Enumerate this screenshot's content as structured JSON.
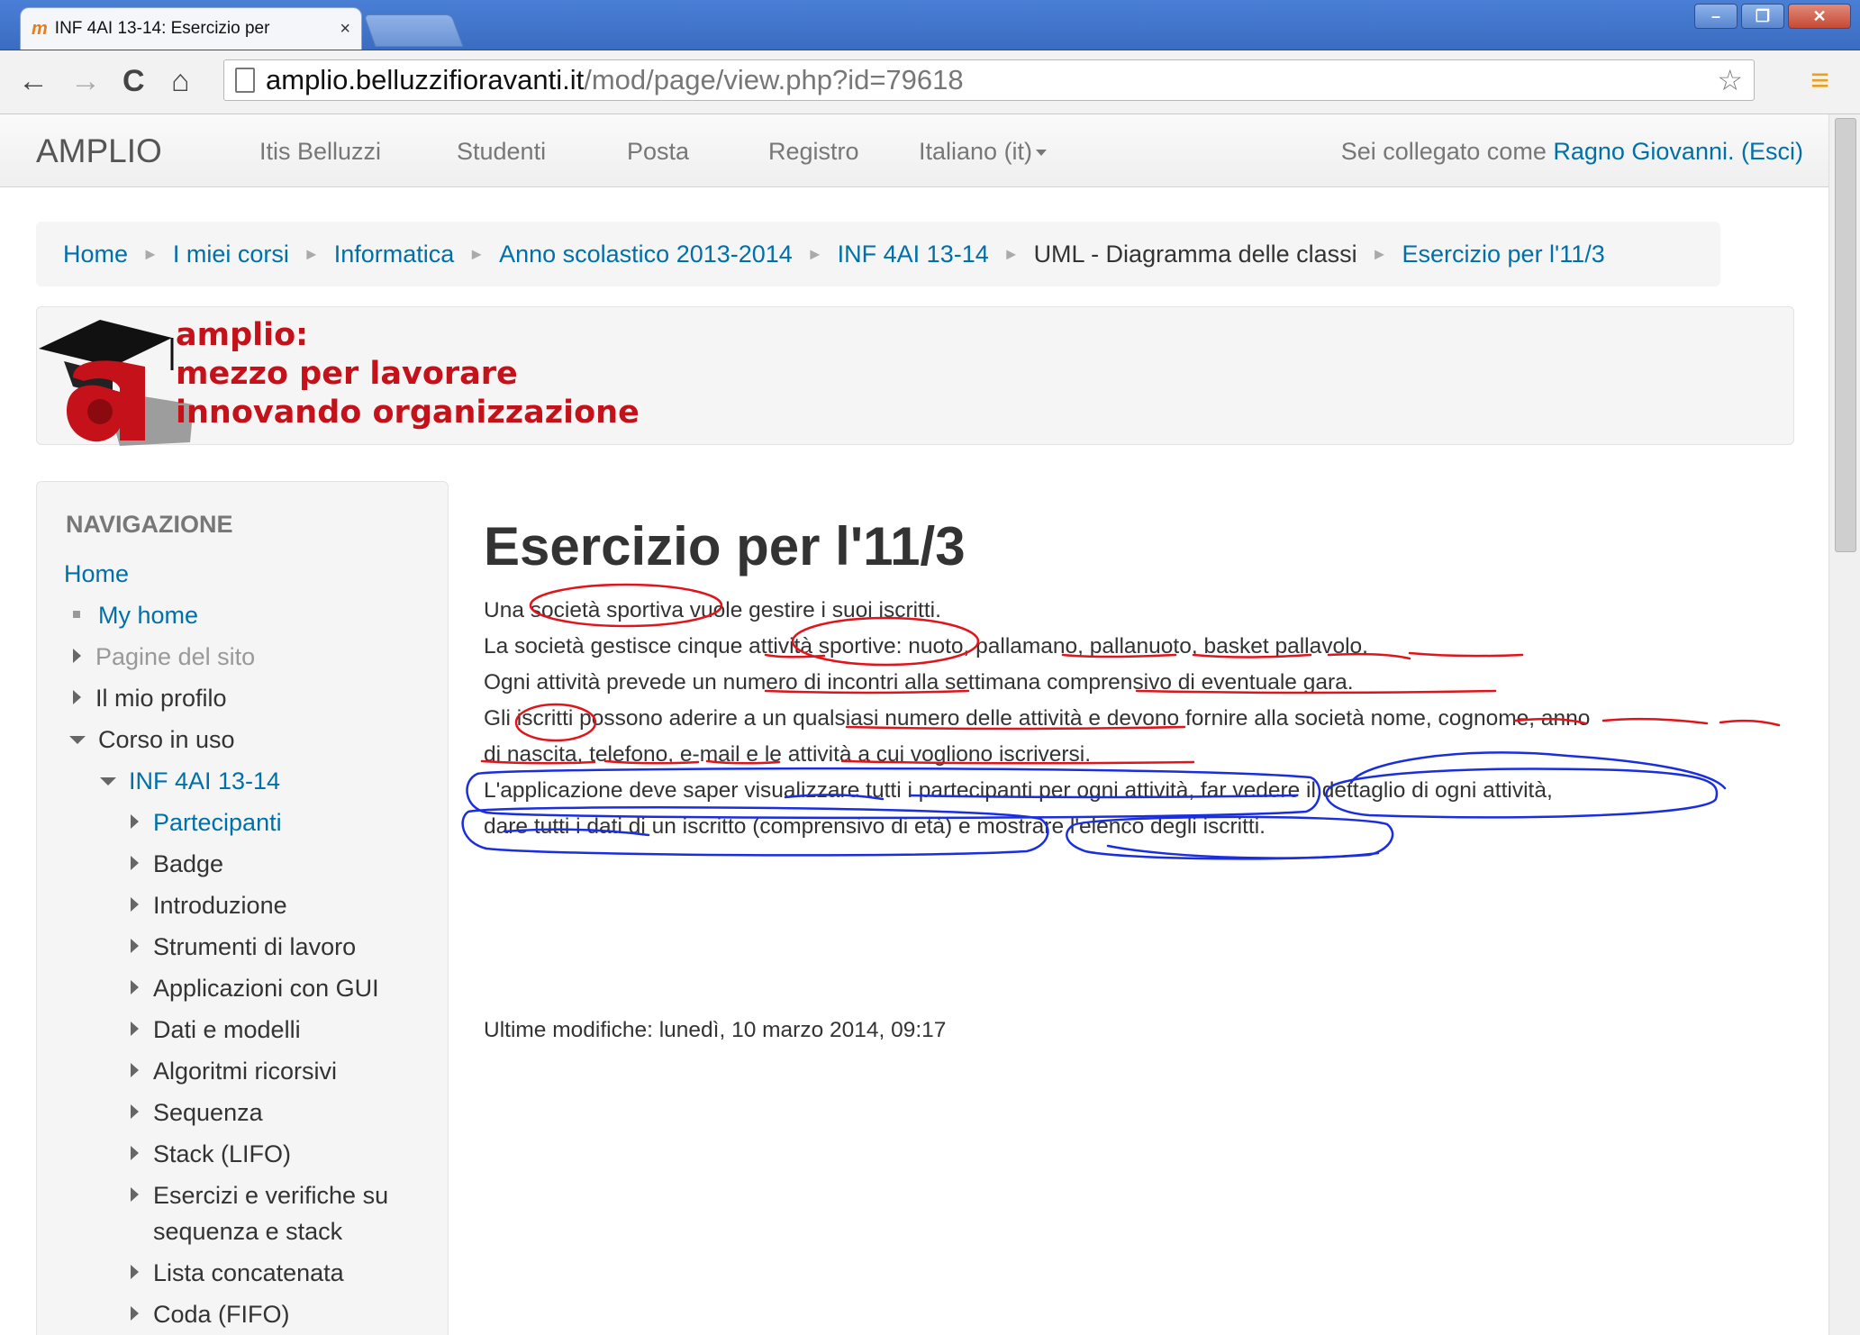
{
  "browser": {
    "tab_title": "INF 4AI 13-14: Esercizio per",
    "tab_close": "×",
    "url_host": "amplio.belluzzifioravanti.it",
    "url_path": "/mod/page/view.php?id=79618",
    "window_buttons": [
      "minimize",
      "maximize",
      "close"
    ]
  },
  "navbar": {
    "brand": "AMPLIO",
    "items": [
      "Itis Belluzzi",
      "Studenti",
      "Posta",
      "Registro",
      "Italiano (it)"
    ],
    "login_prefix": "Sei collegato come ",
    "user": "Ragno Giovanni.",
    "logout": "(Esci)"
  },
  "breadcrumb": [
    "Home",
    "I miei corsi",
    "Informatica",
    "Anno scolastico 2013-2014",
    "INF 4AI 13-14",
    "UML - Diagramma delle classi",
    "Esercizio per l'11/3"
  ],
  "logo": {
    "line1": "amplio:",
    "line2": "mezzo per lavorare",
    "line3": "innovando organizzazione"
  },
  "navigation": {
    "title": "NAVIGAZIONE",
    "home": "Home",
    "my_home": "My home",
    "site_pages": "Pagine del sito",
    "my_profile": "Il mio profilo",
    "current_course": "Corso in uso",
    "course": "INF 4AI 13-14",
    "sections": [
      "Partecipanti",
      "Badge",
      "Introduzione",
      "Strumenti di lavoro",
      "Applicazioni con GUI",
      "Dati e modelli",
      "Algoritmi ricorsivi",
      "Sequenza",
      "Stack (LIFO)",
      "Esercizi e verifiche su",
      "sequenza e stack",
      "Lista concatenata",
      "Coda (FIFO)"
    ]
  },
  "page": {
    "title": "Esercizio per l'11/3",
    "lines": [
      "Una società sportiva vuole gestire i suoi iscritti.",
      "La società gestisce cinque attività sportive: nuoto, pallamano, pallanuoto, basket pallavolo.",
      "Ogni attività prevede un numero di incontri alla settimana comprensivo di eventuale gara.",
      "Gli iscritti possono aderire a un qualsiasi numero delle attività e devono fornire alla società nome, cognome, anno",
      "di nascita, telefono, e-mail e le attività a cui vogliono iscriversi.",
      "L'applicazione deve saper visualizzare tutti i partecipanti per ogni attività, far vedere il dettaglio di ogni attività,",
      "dare tutti i dati di un iscritto (comprensivo di età) e mostrare l'elenco degli iscritti."
    ],
    "last_modified": "Ultime modifiche: lunedì, 10 marzo 2014, 09:17"
  },
  "colors": {
    "link": "#0070a8",
    "annotation_red": "#e0151c",
    "annotation_blue": "#1a2ee0",
    "logo_red": "#c4111a"
  }
}
